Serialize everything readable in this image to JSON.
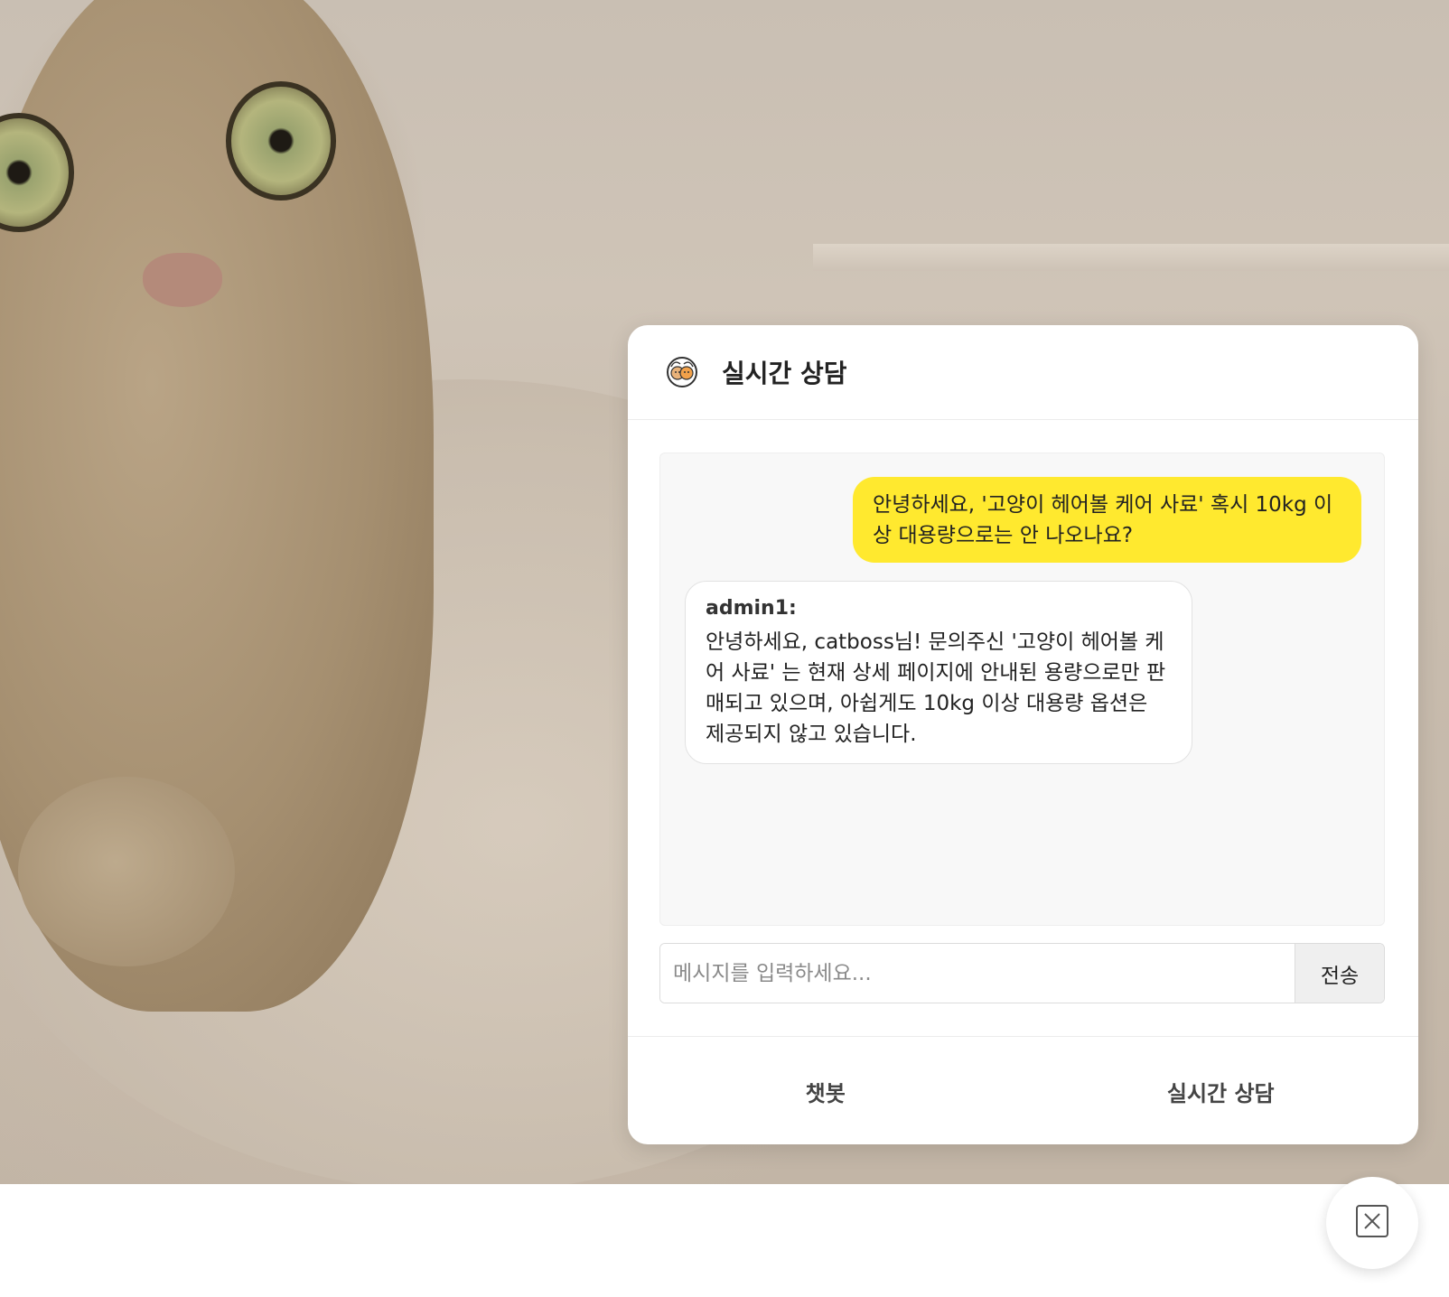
{
  "background": {
    "image_subject": "cat-photo",
    "colors": {
      "fur": "#a58f70",
      "cushion": "#d8cdbf",
      "wall": "#c9bfb3"
    }
  },
  "chat": {
    "header": {
      "logo_icon": "cat-dog-logo-icon",
      "title": "실시간 상담"
    },
    "messages": [
      {
        "sender": "user",
        "text": "안녕하세요, '고양이 헤어볼 케어 사료' 혹시 10kg 이상 대용량으로는 안 나오나요?"
      },
      {
        "sender": "admin1:",
        "text": "안녕하세요, catboss님! 문의주신 '고양이 헤어볼 케어 사료' 는 현재 상세 페이지에 안내된 용량으로만 판매되고 있으며, 아쉽게도 10kg 이상 대용량 옵션은 제공되지 않고 있습니다."
      }
    ],
    "input": {
      "placeholder": "메시지를 입력하세요...",
      "value": ""
    },
    "send_label": "전송",
    "tabs": [
      {
        "label": "챗봇"
      },
      {
        "label": "실시간 상담"
      }
    ],
    "colors": {
      "user_bubble": "#ffe92f",
      "admin_bubble": "#ffffff",
      "messages_bg": "#f8f8f8"
    }
  },
  "close_button": {
    "icon": "close-icon"
  }
}
